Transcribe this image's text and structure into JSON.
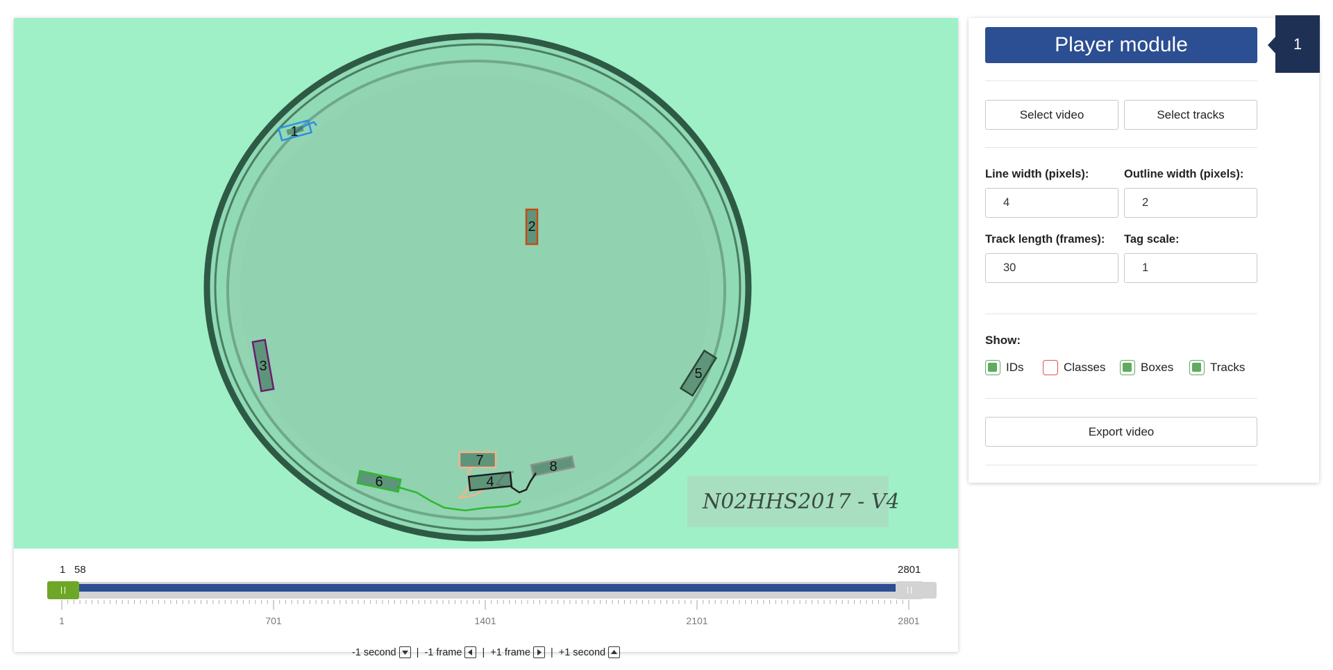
{
  "video": {
    "tracks": [
      {
        "id": "1",
        "color": "#2f8de4"
      },
      {
        "id": "2",
        "color": "#c84a12"
      },
      {
        "id": "3",
        "color": "#6a1d70"
      },
      {
        "id": "4",
        "color": "#1e1e1e"
      },
      {
        "id": "5",
        "color": "#2b4535"
      },
      {
        "id": "6",
        "color": "#2db82d"
      },
      {
        "id": "7",
        "color": "#f2b48a"
      },
      {
        "id": "8",
        "color": "#909090"
      }
    ],
    "label_text": "N02HHS2017 - V4"
  },
  "slider": {
    "min": "1",
    "current": "58",
    "max": "2801",
    "ticks": [
      "1",
      "701",
      "1401",
      "2101",
      "2801"
    ]
  },
  "nav": {
    "minus_second": "-1 second",
    "minus_frame": "-1 frame",
    "plus_frame": "+1 frame",
    "plus_second": "+1 second",
    "sep": "|"
  },
  "panel": {
    "title": "Player module",
    "badge": "1",
    "select_video": "Select video",
    "select_tracks": "Select tracks",
    "line_width_label": "Line width (pixels):",
    "line_width_value": "4",
    "outline_width_label": "Outline width (pixels):",
    "outline_width_value": "2",
    "track_length_label": "Track length (frames):",
    "track_length_value": "30",
    "tag_scale_label": "Tag scale:",
    "tag_scale_value": "1",
    "show_label": "Show:",
    "show_ids": "IDs",
    "show_classes": "Classes",
    "show_boxes": "Boxes",
    "show_tracks": "Tracks",
    "export_video": "Export video"
  },
  "colors": {
    "accent": "#2c4e92",
    "badge": "#1f3055",
    "handle": "#6ea728",
    "checkbox": "#5fab5f",
    "background_green": "#9ff0c6"
  }
}
